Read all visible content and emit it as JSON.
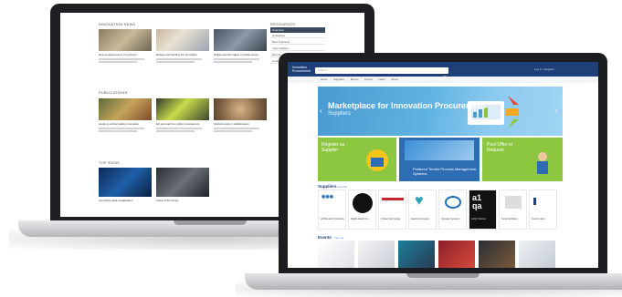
{
  "back_screen": {
    "sections": [
      {
        "title": "INNOVATION NEWS",
        "cards": [
          {
            "title": "Recent advances in AI systems"
          },
          {
            "title": "Budget and funding for innovation"
          },
          {
            "title": "Digital transformation in public sector"
          }
        ]
      },
      {
        "title": "PUBLICATIONS",
        "cards": [
          {
            "title": "Guide to school safety innovation"
          },
          {
            "title": "EU approach to public procurement"
          },
          {
            "title": "Global trends in collaboration"
          }
        ]
      },
      {
        "title": "TOP IDEAS",
        "cards": [
          {
            "title": "Innovative data visualization"
          },
          {
            "title": "Cities of the future"
          }
        ]
      }
    ],
    "sidebar": {
      "title": "RESOURCES",
      "items": [
        "Overview",
        "Guidelines",
        "Best Practices",
        "Case Studies",
        "Events",
        "Contact"
      ]
    }
  },
  "front_screen": {
    "logo_text": "Innovation Procurement",
    "search_placeholder": "Search...",
    "top_right": "Log in  |  Register",
    "nav_items": [
      "Home",
      "Suppliers",
      "Buyers",
      "Events",
      "News",
      "About"
    ],
    "hero": {
      "title": "Marketplace for Innovation Procurement",
      "subtitle": "Suppliers"
    },
    "tiles": [
      {
        "text": "Register as Supplier",
        "color": "#8dc63f"
      },
      {
        "text": "Featured Tender Process Management Systems",
        "color": "#2e6db4"
      },
      {
        "text": "Post Offer or Request",
        "color": "#8dc63f"
      }
    ],
    "suppliers_label": "Suppliers",
    "view_all": "View all",
    "suppliers": [
      {
        "name": "All Biometric Solutions",
        "color": "#1e6fb8"
      },
      {
        "name": "Digital Health Co",
        "color": "#111111"
      },
      {
        "name": "Civitas Technology",
        "color": "#c0272d"
      },
      {
        "name": "Hearts Innovation",
        "color": "#2fa3b5"
      },
      {
        "name": "Citywise Systems",
        "color": "#1e6fb8"
      },
      {
        "name": "A1QA Testing",
        "color": "#111111"
      },
      {
        "name": "Smart Robotics",
        "color": "#333333"
      },
      {
        "name": "Fusion Labs",
        "color": "#1e3f78"
      }
    ],
    "events_label": "Events",
    "events_view_all": "View all",
    "colors": {
      "primary": "#1e3f78",
      "accent": "#8dc63f",
      "hero": "#4a9bd2"
    }
  }
}
